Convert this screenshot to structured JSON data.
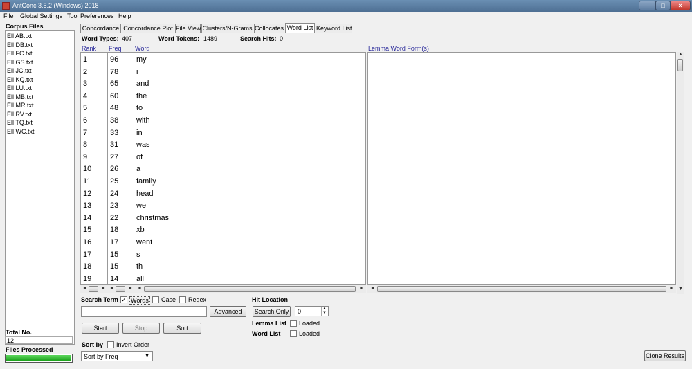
{
  "window": {
    "title": "AntConc 3.5.2 (Windows) 2018",
    "min": "–",
    "max": "□",
    "close": "×"
  },
  "menu": [
    "File",
    "Global Settings",
    "Tool Preferences",
    "Help"
  ],
  "left": {
    "corpus_heading": "Corpus Files",
    "files": [
      "AB.txt",
      "DB.txt",
      "FC.txt",
      "GS.txt",
      "JC.txt",
      "KQ.txt",
      "LU.txt",
      "MB.txt",
      "MR.txt",
      "RV.txt",
      "TQ.txt",
      "WC.txt"
    ],
    "file_prefix": "Ell",
    "total_label": "Total No.",
    "total_value": "12",
    "processed_label": "Files Processed",
    "progress": 1.0
  },
  "tabs": [
    "Concordance",
    "Concordance Plot",
    "File View",
    "Clusters/N-Grams",
    "Collocates",
    "Word List",
    "Keyword List"
  ],
  "active_tab": "Word List",
  "stats": {
    "types_label": "Word Types:",
    "types": "407",
    "tokens_label": "Word Tokens:",
    "tokens": "1489",
    "hits_label": "Search Hits:",
    "hits": "0"
  },
  "columns": {
    "rank": "Rank",
    "freq": "Freq",
    "word": "Word",
    "lemma": "Lemma Word Form(s)"
  },
  "rows": [
    {
      "rank": "1",
      "freq": "96",
      "word": "my"
    },
    {
      "rank": "2",
      "freq": "78",
      "word": "i"
    },
    {
      "rank": "3",
      "freq": "65",
      "word": "and"
    },
    {
      "rank": "4",
      "freq": "60",
      "word": "the"
    },
    {
      "rank": "5",
      "freq": "48",
      "word": "to"
    },
    {
      "rank": "6",
      "freq": "38",
      "word": "with"
    },
    {
      "rank": "7",
      "freq": "33",
      "word": "in"
    },
    {
      "rank": "8",
      "freq": "31",
      "word": "was"
    },
    {
      "rank": "9",
      "freq": "27",
      "word": "of"
    },
    {
      "rank": "10",
      "freq": "26",
      "word": "a"
    },
    {
      "rank": "11",
      "freq": "25",
      "word": "family"
    },
    {
      "rank": "12",
      "freq": "24",
      "word": "head"
    },
    {
      "rank": "13",
      "freq": "23",
      "word": "we"
    },
    {
      "rank": "14",
      "freq": "22",
      "word": "christmas"
    },
    {
      "rank": "15",
      "freq": "18",
      "word": "xb"
    },
    {
      "rank": "16",
      "freq": "17",
      "word": "went"
    },
    {
      "rank": "17",
      "freq": "15",
      "word": "s"
    },
    {
      "rank": "18",
      "freq": "15",
      "word": "th"
    },
    {
      "rank": "19",
      "freq": "14",
      "word": "all"
    }
  ],
  "search": {
    "term_label": "Search Term",
    "words_label": "Words",
    "words_checked": true,
    "case_label": "Case",
    "case_checked": false,
    "regex_label": "Regex",
    "regex_checked": false,
    "value": "",
    "advanced": "Advanced",
    "start": "Start",
    "stop": "Stop",
    "sort": "Sort",
    "sort_by_label": "Sort by",
    "invert_label": "Invert Order",
    "sort_option": "Sort by Freq"
  },
  "hit": {
    "location_label": "Hit Location",
    "search_only": "Search Only",
    "spinner_value": "0",
    "lemma_label": "Lemma List",
    "word_label": "Word List",
    "loaded": "Loaded"
  },
  "clone": "Clone Results"
}
